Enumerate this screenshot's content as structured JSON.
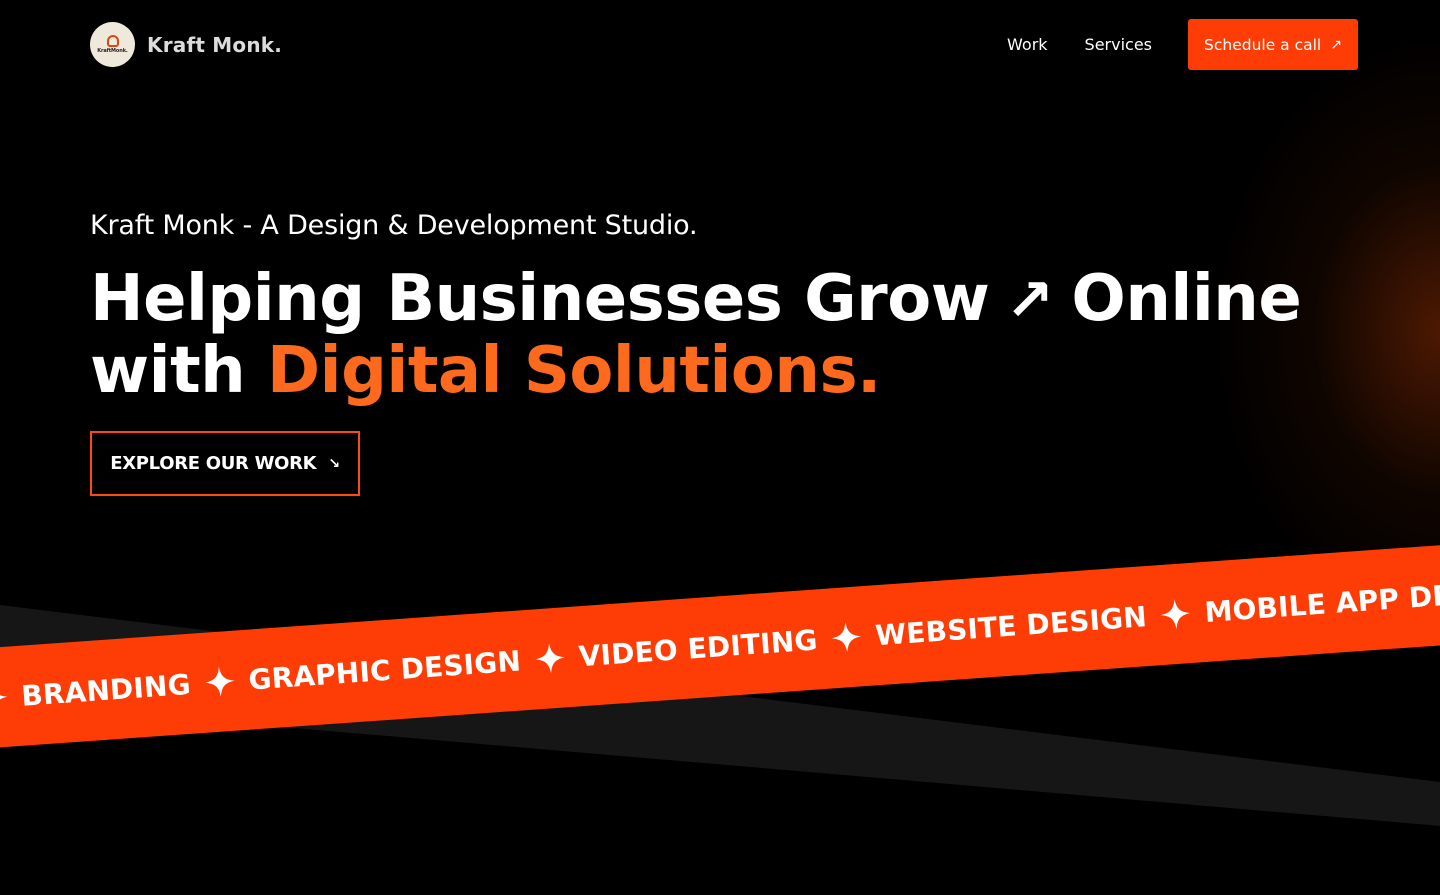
{
  "brand": {
    "logo_text": "KraftMonk.",
    "name": "Kraft Monk."
  },
  "nav": {
    "items": [
      {
        "label": "Work"
      },
      {
        "label": "Services"
      }
    ],
    "cta_label": "Schedule a call",
    "cta_icon": "arrow-up-right-icon"
  },
  "hero": {
    "subtitle": "Kraft Monk - A Design & Development Studio.",
    "title_part1": "Helping Businesses Grow",
    "title_part2": "Online",
    "title_part3": "with",
    "title_accent": "Digital Solutions.",
    "explore_label": "EXPLORE OUR WORK",
    "explore_icon": "arrow-down-right-icon"
  },
  "ribbon": {
    "items": [
      "BRANDING",
      "GRAPHIC DESIGN",
      "VIDEO EDITING",
      "WEBSITE DESIGN",
      "MOBILE APP DESIGN"
    ],
    "separator_icon": "sparkle-star-icon"
  },
  "colors": {
    "accent": "#fd3d05",
    "accent_text": "#fd6a1e",
    "background": "#000000",
    "dark_band": "#161617"
  }
}
